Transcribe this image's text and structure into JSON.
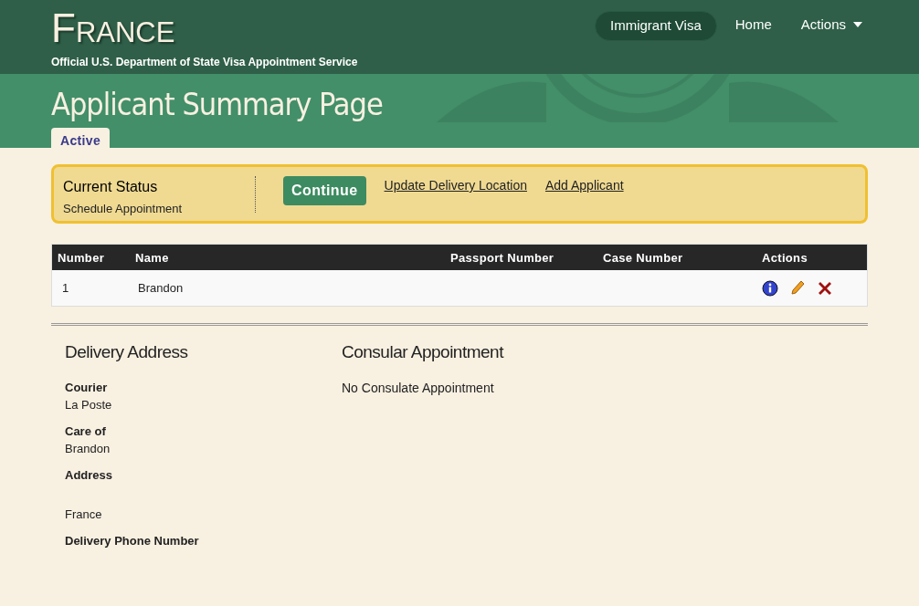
{
  "header": {
    "country": "France",
    "subtitle": "Official U.S. Department of State Visa Appointment Service",
    "nav": [
      {
        "kind": "pill",
        "label": "Immigrant Visa",
        "selected": true
      },
      {
        "kind": "link",
        "label": "Home",
        "selected": false
      },
      {
        "kind": "dropdown",
        "label": "Actions",
        "selected": false
      }
    ]
  },
  "page_title": "Applicant Summary Page",
  "tabs": [
    {
      "label": "Active",
      "selected": true
    }
  ],
  "status": {
    "title": "Current Status",
    "value": "Schedule Appointment",
    "button": "Continue",
    "links": [
      "Update Delivery Location",
      "Add Applicant"
    ]
  },
  "table": {
    "columns": [
      "Number",
      "Name",
      "Passport Number",
      "Case Number",
      "Actions"
    ],
    "rows": [
      {
        "number": "1",
        "name": "Brandon"
      }
    ]
  },
  "delivery": {
    "title": "Delivery Address",
    "fields": [
      {
        "label": "Courier",
        "value": "La Poste"
      },
      {
        "label": "Care of",
        "value": "Brandon"
      },
      {
        "label": "Address",
        "value": "France"
      },
      {
        "label": "Delivery Phone Number"
      }
    ]
  },
  "consular": {
    "title": "Consular Appointment",
    "text": "No Consulate Appointment"
  }
}
